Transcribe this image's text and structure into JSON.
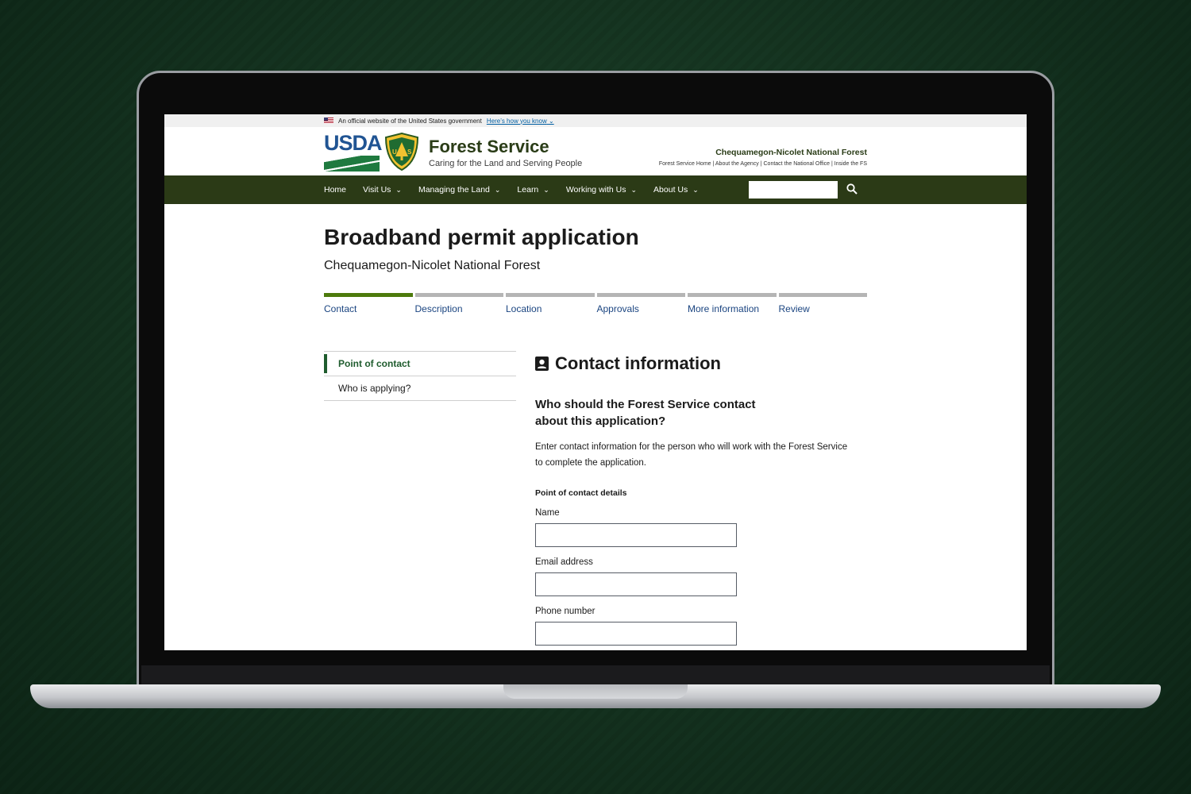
{
  "gov_banner": {
    "text": "An official website of the United States government",
    "link": "Here’s how you know"
  },
  "header": {
    "usda": "USDA",
    "title": "Forest Service",
    "tagline": "Caring for the Land and Serving People",
    "forest_name": "Chequamegon-Nicolet National Forest",
    "util_links": [
      "Forest Service Home",
      "About the Agency",
      "Contact the National Office",
      "Inside the FS"
    ]
  },
  "nav": {
    "items": [
      {
        "label": "Home"
      },
      {
        "label": "Visit Us"
      },
      {
        "label": "Managing the Land"
      },
      {
        "label": "Learn"
      },
      {
        "label": "Working with Us"
      },
      {
        "label": "About Us"
      }
    ]
  },
  "page": {
    "title": "Broadband permit application",
    "subtitle": "Chequamegon-Nicolet National Forest"
  },
  "steps": [
    {
      "label": "Contact",
      "active": true
    },
    {
      "label": "Description",
      "active": false
    },
    {
      "label": "Location",
      "active": false
    },
    {
      "label": "Approvals",
      "active": false
    },
    {
      "label": "More information",
      "active": false
    },
    {
      "label": "Review",
      "active": false
    }
  ],
  "sidenav": [
    {
      "label": "Point of contact",
      "current": true
    },
    {
      "label": "Who is applying?",
      "current": false
    }
  ],
  "form": {
    "section_title": "Contact information",
    "question": "Who should the Forest Service contact about this application?",
    "help": "Enter contact information for the person who will work with the Forest Service to complete the application.",
    "legend": "Point of contact details",
    "fields": [
      {
        "label": "Name",
        "value": ""
      },
      {
        "label": "Email address",
        "value": ""
      },
      {
        "label": "Phone number",
        "value": ""
      }
    ]
  },
  "colors": {
    "nav_bg": "#2b3a16",
    "progress_active": "#4d7a0c",
    "progress_inactive": "#b5b5b5",
    "link": "#1a4480",
    "sidenav_current": "#1f5c2e"
  }
}
